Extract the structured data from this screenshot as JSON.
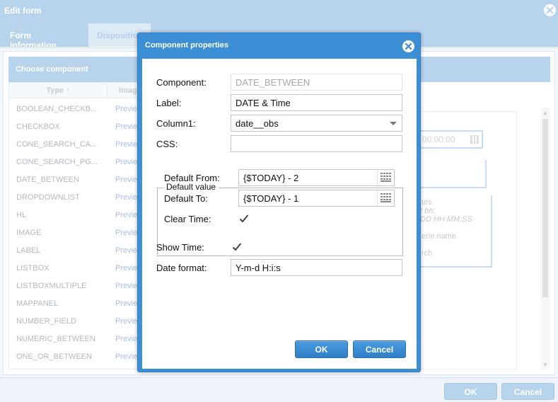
{
  "background_window": {
    "title": "Edit form",
    "tabs": [
      "Form Information",
      "Dispositio"
    ],
    "choose_component_title": "Choose component",
    "grid": {
      "col_type": "Type ↑",
      "col_image": "Imag",
      "rows": [
        {
          "type": "BOOLEAN_CHECKB...",
          "link": "Previe"
        },
        {
          "type": "CHECKBOX",
          "link": "Previe"
        },
        {
          "type": "CONE_SEARCH_CA...",
          "link": "Previe"
        },
        {
          "type": "CONE_SEARCH_PG...",
          "link": "Previe"
        },
        {
          "type": "DATE_BETWEEN",
          "link": "Previe"
        },
        {
          "type": "DROPDOWNLIST",
          "link": "Previe"
        },
        {
          "type": "HL",
          "link": "Previe"
        },
        {
          "type": "IMAGE",
          "link": "Previe"
        },
        {
          "type": "LABEL",
          "link": "Previe"
        },
        {
          "type": "LISTBOX",
          "link": "Previe"
        },
        {
          "type": "LISTBOXMULTIPLE",
          "link": "Previe"
        },
        {
          "type": "MAPPANEL",
          "link": "Previe"
        },
        {
          "type": "NUMBER_FIELD",
          "link": "Previe"
        },
        {
          "type": "NUMERIC_BETWEEN",
          "link": "Previe"
        },
        {
          "type": "ONE_OR_BETWEEN",
          "link": "Previe"
        }
      ]
    },
    "preview": {
      "time_text": "00:00:00",
      "line1": "tes",
      "line2": "t be:",
      "line3": "DD HH:MM:SS",
      "line4": "erie name",
      "line5": "rch"
    },
    "ok_label": "OK",
    "cancel_label": "Cancel"
  },
  "dialog": {
    "title": "Component properties",
    "component_label": "Component:",
    "component_value": "DATE_BETWEEN",
    "label_label": "Label:",
    "label_value": "DATE & Time",
    "column1_label": "Column1:",
    "column1_value": "date__obs",
    "css_label": "CSS:",
    "css_value": "",
    "default_value_legend": "Default value",
    "default_from_label": "Default From:",
    "default_from_value": "{$TODAY} - 2",
    "default_to_label": "Default To:",
    "default_to_value": "{$TODAY} - 1",
    "clear_time_label": "Clear Time:",
    "clear_time_checked": true,
    "show_time_label": "Show Time:",
    "show_time_checked": true,
    "date_format_label": "Date format:",
    "date_format_value": "Y-m-d H:i:s",
    "ok_label": "OK",
    "cancel_label": "Cancel"
  },
  "colors": {
    "dialog_header": "#3d8fd5",
    "button_blue": "#2f7fc6",
    "background_header": "#b8d4ed"
  }
}
